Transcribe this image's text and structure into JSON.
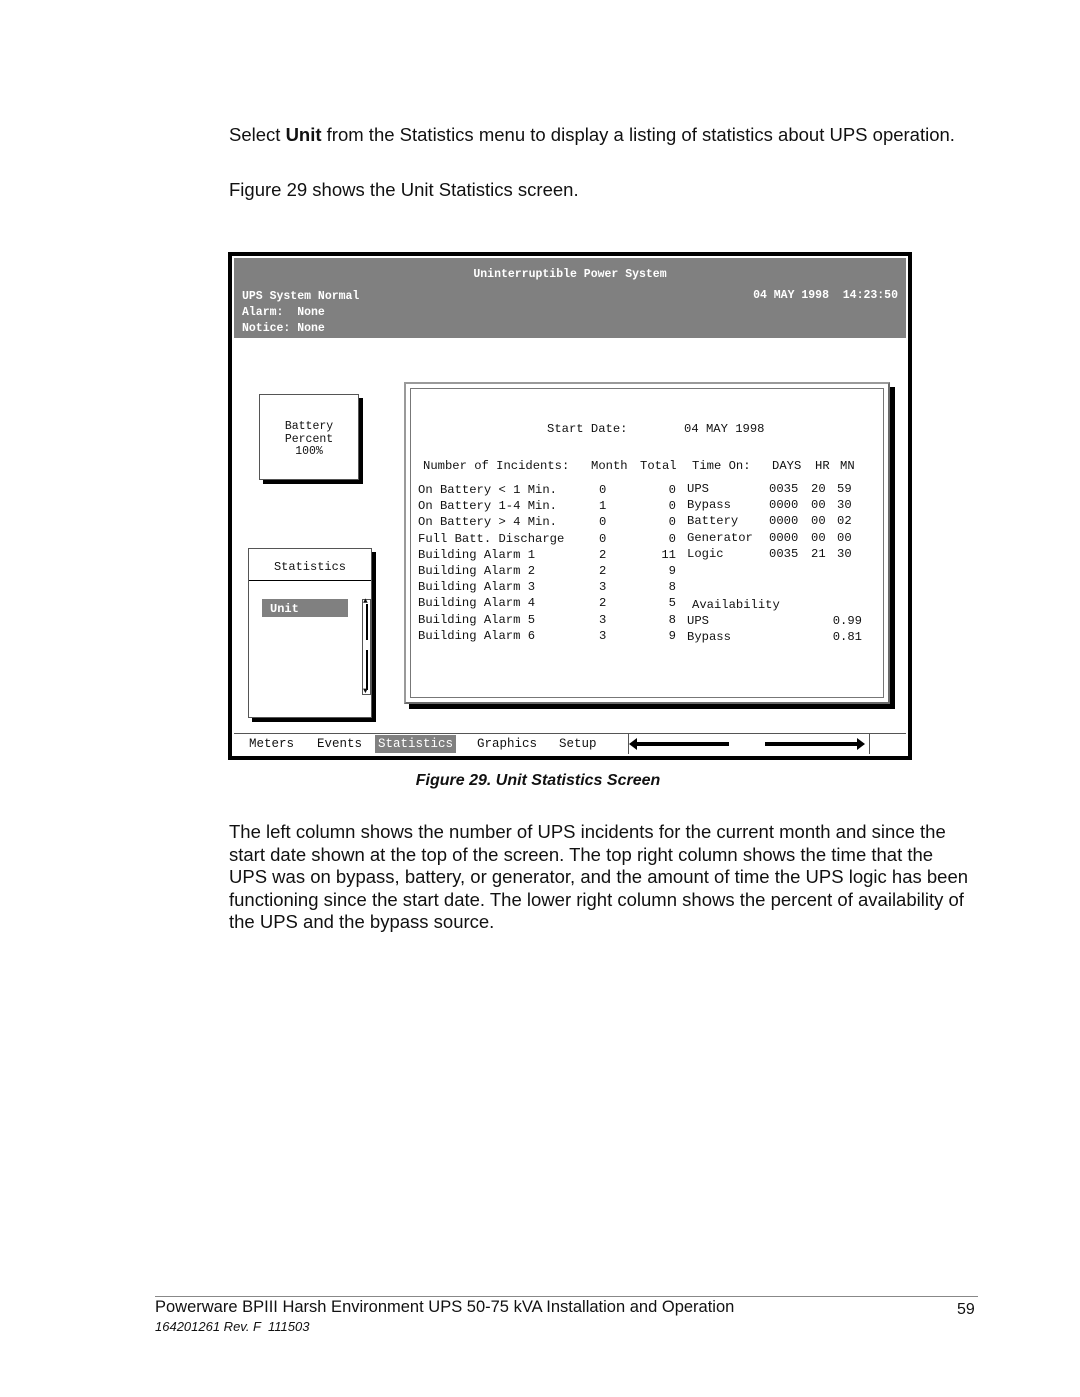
{
  "intro": {
    "p1_before": "Select ",
    "p1_bold": "Unit",
    "p1_after": " from the Statistics menu to display a listing of statistics about UPS operation.",
    "p2": "Figure 29 shows the Unit Statistics screen."
  },
  "screen": {
    "header": {
      "title": "Uninterruptible Power System",
      "status": "UPS System Normal",
      "alarm": "Alarm:  None",
      "notice": "Notice: None",
      "datetime": "04 MAY 1998  14:23:50"
    },
    "battery": {
      "line1": "Battery",
      "line2": "Percent",
      "value": "100%"
    },
    "statistics_menu": {
      "title": "Statistics",
      "items": [
        {
          "label": "Unit",
          "selected": true
        }
      ]
    },
    "panel": {
      "start_date_label": "Start Date:",
      "start_date_value": "04 MAY 1998",
      "incidents_header": "Number of Incidents:",
      "month_header": "Month",
      "total_header": "Total",
      "time_on_header": "Time On:",
      "days_header": "DAYS",
      "hr_header": "HR",
      "mn_header": "MN",
      "incidents": [
        {
          "label": "On Battery < 1 Min.",
          "month": "0",
          "total": "0"
        },
        {
          "label": "On Battery 1-4 Min.",
          "month": "1",
          "total": "0"
        },
        {
          "label": "On Battery > 4 Min.",
          "month": "0",
          "total": "0"
        },
        {
          "label": "Full Batt. Discharge",
          "month": "0",
          "total": "0"
        },
        {
          "label": "Building Alarm 1",
          "month": "2",
          "total": "11"
        },
        {
          "label": "Building Alarm 2",
          "month": "2",
          "total": "9"
        },
        {
          "label": "Building Alarm 3",
          "month": "3",
          "total": "8"
        },
        {
          "label": "Building Alarm 4",
          "month": "2",
          "total": "5"
        },
        {
          "label": "Building Alarm 5",
          "month": "3",
          "total": "8"
        },
        {
          "label": "Building Alarm 6",
          "month": "3",
          "total": "9"
        }
      ],
      "time_on": [
        {
          "label": "UPS",
          "days": "0035",
          "hr": "20",
          "mn": "59"
        },
        {
          "label": "Bypass",
          "days": "0000",
          "hr": "00",
          "mn": "30"
        },
        {
          "label": "Battery",
          "days": "0000",
          "hr": "00",
          "mn": "02"
        },
        {
          "label": "Generator",
          "days": "0000",
          "hr": "00",
          "mn": "00"
        },
        {
          "label": "Logic",
          "days": "0035",
          "hr": "21",
          "mn": "30"
        }
      ],
      "availability_header": "Availability",
      "availability": [
        {
          "label": "UPS",
          "value": "0.99"
        },
        {
          "label": "Bypass",
          "value": "0.81"
        }
      ]
    },
    "menubar": {
      "items": [
        {
          "label": "Meters",
          "active": false
        },
        {
          "label": "Events",
          "active": false
        },
        {
          "label": "Statistics",
          "active": true
        },
        {
          "label": "Graphics",
          "active": false
        },
        {
          "label": "Setup",
          "active": false
        }
      ],
      "left_arrow": "arrow-left-icon",
      "right_arrow": "arrow-right-icon"
    }
  },
  "caption": "Figure 29.  Unit Statistics Screen",
  "body_paragraph": "The left column shows the number of UPS incidents for the current month and since the start date shown at the top of the screen.  The top right column shows the time that the UPS was on bypass, battery, or generator, and the amount of time the UPS logic has been functioning since the start date.  The lower right column shows the percent of availability of the UPS and the bypass source.",
  "footer": {
    "title": "Powerware BPIII Harsh Environment UPS 50-75 kVA Installation and Operation",
    "page_number": "59",
    "doc_number": "164201261 Rev. F  111503"
  }
}
